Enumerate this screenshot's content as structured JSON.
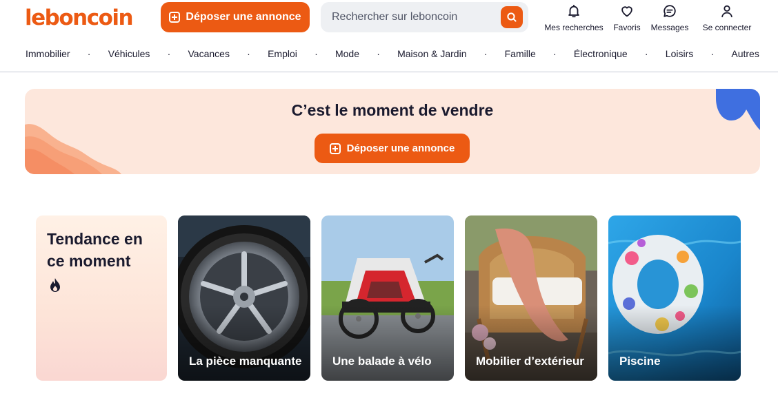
{
  "header": {
    "logo": "leboncoin",
    "deposit_label": "Déposer une annonce",
    "search_placeholder": "Rechercher sur leboncoin",
    "nav": [
      {
        "label": "Mes recherches",
        "icon": "bell-icon"
      },
      {
        "label": "Favoris",
        "icon": "heart-icon"
      },
      {
        "label": "Messages",
        "icon": "chat-icon"
      },
      {
        "label": "Se connecter",
        "icon": "user-icon"
      }
    ]
  },
  "categories": [
    "Immobilier",
    "Véhicules",
    "Vacances",
    "Emploi",
    "Mode",
    "Maison & Jardin",
    "Famille",
    "Électronique",
    "Loisirs",
    "Autres"
  ],
  "banner": {
    "title": "C’est le moment de vendre",
    "button_label": "Déposer une annonce"
  },
  "trending": {
    "title": "Tendance en ce moment",
    "icon": "flame-icon"
  },
  "cards": [
    {
      "title": "La pièce manquante"
    },
    {
      "title": "Une balade à vélo"
    },
    {
      "title": "Mobilier d’extérieur"
    },
    {
      "title": "Piscine"
    }
  ],
  "colors": {
    "brand": "#ec5a13",
    "banner_bg": "#fde7dc",
    "text": "#1a1a2e"
  }
}
